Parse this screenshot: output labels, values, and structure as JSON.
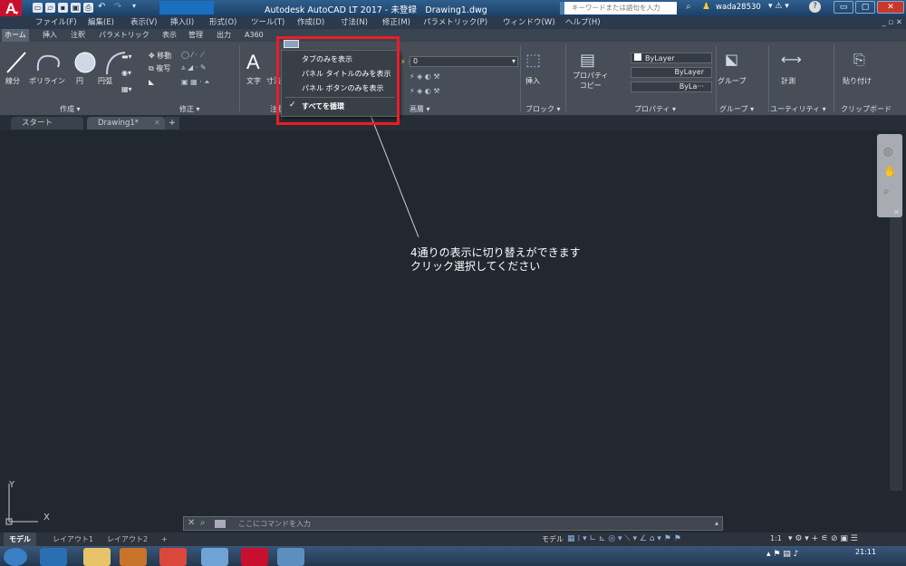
{
  "title": {
    "app_title": "Autodesk AutoCAD LT 2017 - 未登録　Drawing1.dwg",
    "search_placeholder": "キーワードまたは語句を入力",
    "user": "wada28530",
    "logo_letter": "A",
    "logo_sub": "LT"
  },
  "menu": [
    "ファイル(F)",
    "編集(E)",
    "表示(V)",
    "挿入(I)",
    "形式(O)",
    "ツール(T)",
    "作成(D)",
    "寸法(N)",
    "修正(M)",
    "パラメトリック(P)",
    "ウィンドウ(W)",
    "ヘルプ(H)"
  ],
  "ribbon_tabs": [
    "ホーム",
    "挿入",
    "注釈",
    "パラメトリック",
    "表示",
    "管理",
    "出力",
    "A360"
  ],
  "ribbon": {
    "draw_tools": [
      "線分",
      "ポリライン",
      "円",
      "円弧"
    ],
    "modify_tools": [
      "移動",
      "複写"
    ],
    "text_tool": "文字",
    "dim_tool": "寸法",
    "insert_tool": "挿入",
    "props_tool": "プロパティ\nコピー",
    "group_tool": "グループ",
    "measure_tool": "計測",
    "paste_tool": "貼り付け",
    "layer_value": "0",
    "bylayer_color": "ByLayer",
    "bylayer_line": "ByLayer",
    "bylayer_weight": "ByLa···",
    "panels": [
      "作成 ▾",
      "修正 ▾",
      "注釈 ▾",
      "画層 ▾",
      "ブロック ▾",
      "プロパティ ▾",
      "グループ ▾",
      "ユーティリティ ▾",
      "クリップボード"
    ]
  },
  "popup": {
    "items": [
      "タブのみを表示",
      "パネル タイトルのみを表示",
      "パネル ボタンのみを表示",
      "すべてを循環"
    ],
    "checked_index": 3
  },
  "doc_tabs": [
    "スタート",
    "Drawing1*"
  ],
  "annotation": [
    "4通りの表示に切り替えができます",
    "クリック選択してください"
  ],
  "command_placeholder": "ここにコマンドを入力",
  "layout_tabs": [
    "モデル",
    "レイアウト1",
    "レイアウト2"
  ],
  "status": {
    "model": "モデル",
    "scale": "1:1"
  },
  "clock": "21:11",
  "axis": {
    "x": "X",
    "y": "Y"
  },
  "colors": {
    "accent_red": "#ee1c25",
    "title_bar": "#2e5f8f",
    "canvas": "#212830",
    "ribbon": "#474e58"
  }
}
